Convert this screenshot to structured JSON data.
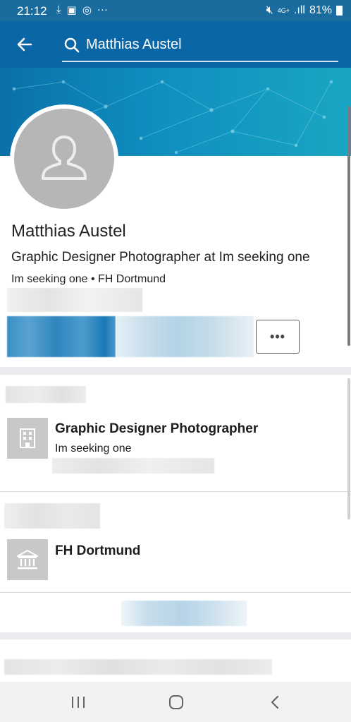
{
  "status_bar": {
    "time": "21:12",
    "network": "4G+",
    "battery": "81%",
    "icons": [
      "download-icon",
      "gallery-icon",
      "sync-icon",
      "more-dots-icon",
      "mute-icon",
      "signal-icon",
      "battery-icon"
    ]
  },
  "search": {
    "query": "Matthias Austel"
  },
  "profile": {
    "name": "Matthias Austel",
    "headline": "Graphic Designer Photographer at Im seeking one",
    "subline": "Im seeking one • FH Dortmund",
    "more_label": "•••"
  },
  "experience": {
    "title": "Graphic Designer Photographer",
    "company": "Im seeking one"
  },
  "education": {
    "school": "FH Dortmund"
  },
  "colors": {
    "app_bar": "#0a66a5",
    "status_bar": "#1a6c9e",
    "logo_placeholder": "#c8c8c8"
  }
}
